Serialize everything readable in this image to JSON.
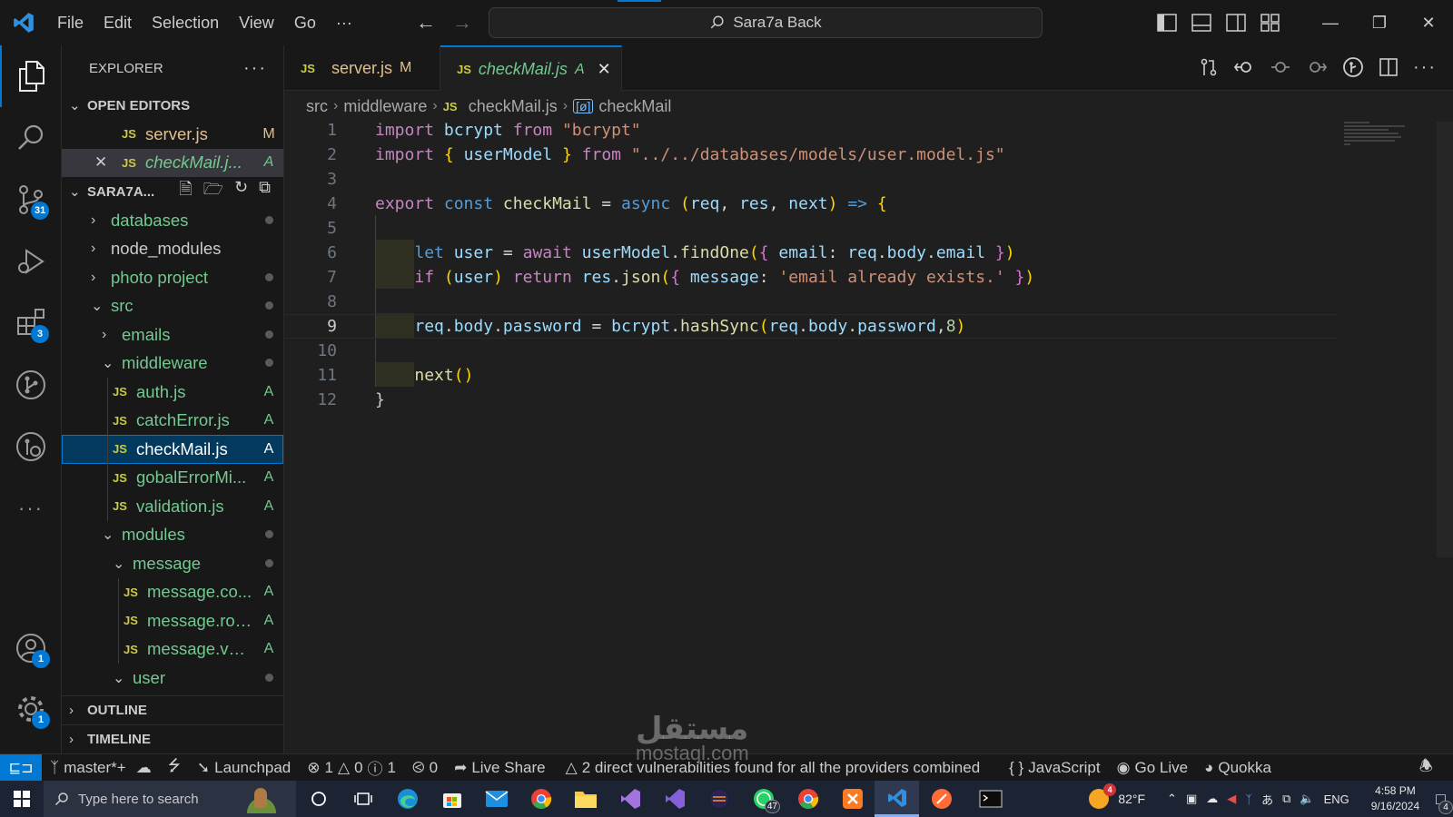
{
  "menu": [
    "File",
    "Edit",
    "Selection",
    "View",
    "Go",
    "···"
  ],
  "command_center": "Sara7a Back",
  "sidebar": {
    "title": "EXPLORER",
    "more": "···",
    "open_editors_title": "OPEN EDITORS",
    "open_editors": [
      {
        "name": "server.js",
        "status": "M"
      },
      {
        "name": "checkMail.j...",
        "status": "A"
      }
    ],
    "project_title": "SARA7A...",
    "tree": [
      {
        "name": "databases",
        "type": "folder-closed",
        "depth": 1
      },
      {
        "name": "node_modules",
        "type": "folder-closed",
        "depth": 1
      },
      {
        "name": "photo project",
        "type": "folder-closed",
        "depth": 1
      },
      {
        "name": "src",
        "type": "folder-open",
        "depth": 1
      },
      {
        "name": "emails",
        "type": "folder-closed",
        "depth": 2
      },
      {
        "name": "middleware",
        "type": "folder-open",
        "depth": 2
      },
      {
        "name": "auth.js",
        "type": "file",
        "depth": 3,
        "status": "A"
      },
      {
        "name": "catchError.js",
        "type": "file",
        "depth": 3,
        "status": "A"
      },
      {
        "name": "checkMail.js",
        "type": "file",
        "depth": 3,
        "status": "A"
      },
      {
        "name": "gobalErrorMi...",
        "type": "file",
        "depth": 3,
        "status": "A"
      },
      {
        "name": "validation.js",
        "type": "file",
        "depth": 3,
        "status": "A"
      },
      {
        "name": "modules",
        "type": "folder-open",
        "depth": 2
      },
      {
        "name": "message",
        "type": "folder-open",
        "depth": 3
      },
      {
        "name": "message.co...",
        "type": "file",
        "depth": 4,
        "status": "A"
      },
      {
        "name": "message.rou...",
        "type": "file",
        "depth": 4,
        "status": "A"
      },
      {
        "name": "message.vali...",
        "type": "file",
        "depth": 4,
        "status": "A"
      },
      {
        "name": "user",
        "type": "folder-open",
        "depth": 3
      }
    ],
    "outline_title": "OUTLINE",
    "timeline_title": "TIMELINE"
  },
  "activity_badges": {
    "source_control": "31",
    "extensions": "3",
    "accounts": "1",
    "settings": "1"
  },
  "tabs": [
    {
      "name": "server.js",
      "status": "M"
    },
    {
      "name": "checkMail.js",
      "status": "A"
    }
  ],
  "breadcrumb": [
    "src",
    "middleware",
    "checkMail.js",
    "checkMail"
  ],
  "editor": {
    "line_numbers": [
      "1",
      "2",
      "3",
      "4",
      "5",
      "6",
      "7",
      "8",
      "9",
      "10",
      "11",
      "12"
    ],
    "lines": [
      "import bcrypt from \"bcrypt\"",
      "import { userModel } from \"../../databases/models/user.model.js\"",
      "",
      "export const checkMail = async (req, res, next) => {",
      "",
      "    let user = await userModel.findOne({ email: req.body.email })",
      "    if (user) return res.json({ message: 'email already exists.' })",
      "",
      "    req.body.password = bcrypt.hashSync(req.body.password,8)",
      "",
      "    next()",
      "}"
    ],
    "current_line": 9
  },
  "statusbar": {
    "branch": "master*+",
    "launchpad": "Launchpad",
    "errors": "1",
    "warnings": "0",
    "infos": "1",
    "ports": "0",
    "live_share": "Live Share",
    "vulnerabilities": "2 direct vulnerabilities found for all the providers combined",
    "language": "JavaScript",
    "go_live": "Go Live",
    "quokka": "Quokka"
  },
  "taskbar": {
    "search_placeholder": "Type here to search",
    "whatsapp_badge": "47",
    "weather_badge": "4",
    "temperature": "82°F",
    "lang": "ENG",
    "time": "4:58 PM",
    "date": "9/16/2024",
    "notif_badge": "4"
  },
  "watermark": {
    "arabic": "مستقل",
    "latin": "mostaql.com"
  },
  "colors": {
    "accent": "#0078d4",
    "added": "#73c991",
    "modified": "#e2c08d",
    "js_icon": "#cbcb41"
  }
}
